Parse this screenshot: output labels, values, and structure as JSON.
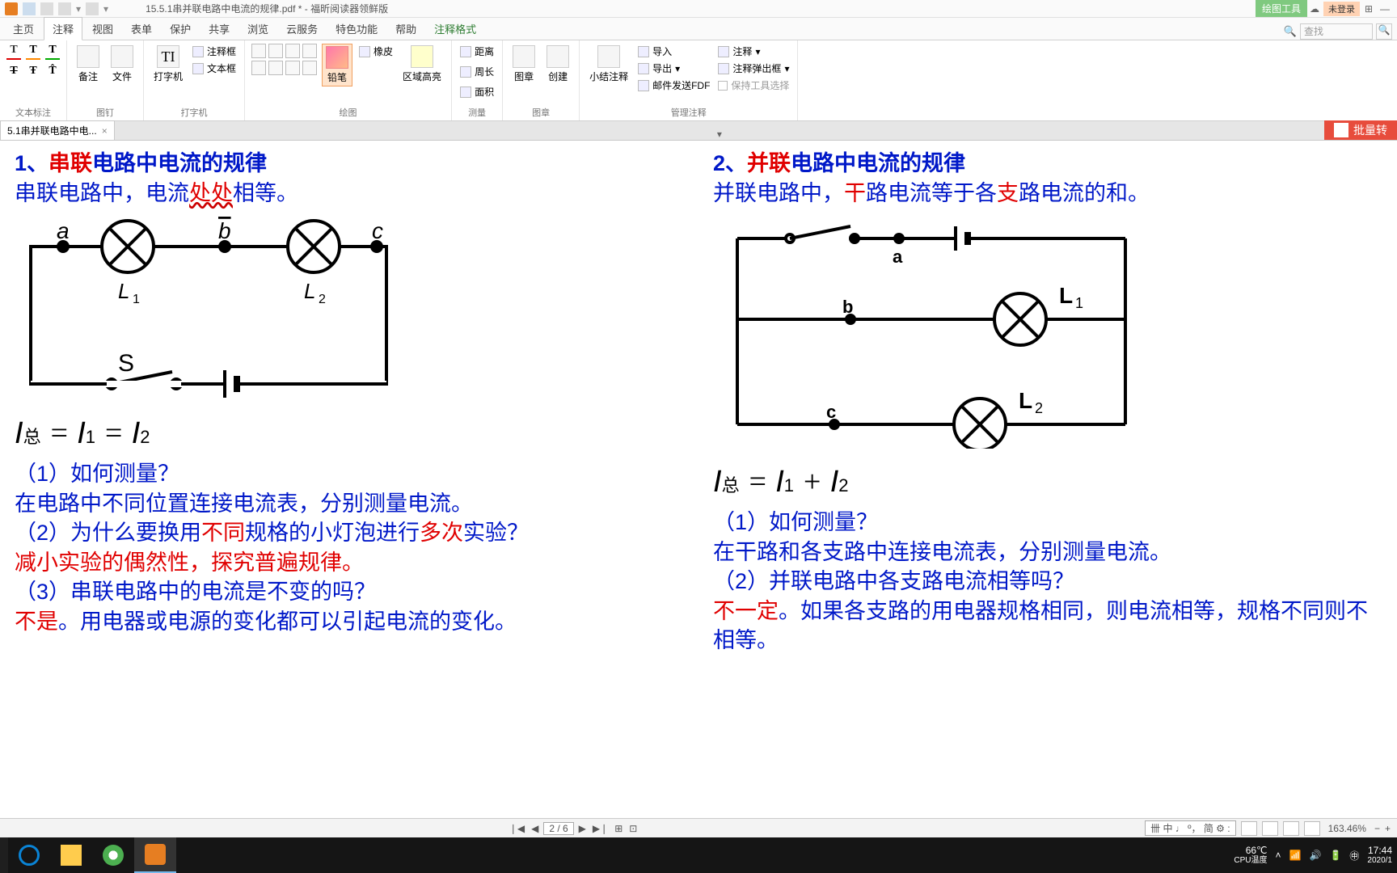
{
  "titlebar": {
    "doc_title": "15.5.1串并联电路中电流的规律.pdf * - 福昕阅读器领鲜版",
    "context_tab": "绘图工具",
    "login": "未登录"
  },
  "ribbon_tabs": [
    "主页",
    "注释",
    "视图",
    "表单",
    "保护",
    "共享",
    "浏览",
    "云服务",
    "特色功能",
    "帮助",
    "注释格式"
  ],
  "active_tab_index": 1,
  "search": {
    "placeholder": "查找"
  },
  "ribbon": {
    "groups": {
      "text_mark": "文本标注",
      "pin": "图钉",
      "typewriter": "打字机",
      "draw": "绘图",
      "measure": "测量",
      "stamp": "图章",
      "manage": "管理注释"
    },
    "btns": {
      "note": "备注",
      "file": "文件",
      "typewriter": "打字机",
      "annot_box": "注释框",
      "text_box": "文本框",
      "pencil": "铅笔",
      "pencil_active": true,
      "eraser": "橡皮",
      "area_hl": "区域高亮",
      "distance": "距离",
      "perimeter": "周长",
      "area": "面积",
      "stamp": "图章",
      "create": "创建",
      "summary": "小结注释",
      "import": "导入",
      "export": "导出",
      "send_fdf": "邮件发送FDF",
      "annot_cmd": "注释",
      "popup": "注释弹出框",
      "keep_tool": "保持工具选择"
    }
  },
  "doc_tab": {
    "label": "5.1串并联电路中电...",
    "right_pill": "批量转",
    "dropdown": "▾"
  },
  "content": {
    "left": {
      "h1a": "1、",
      "h1b": "串联",
      "h1c": "电路中电流的规律",
      "p1a": "串联电路中，电流",
      "p1b": "处处",
      "p1c": "相等。",
      "labels": {
        "a": "a",
        "b": "b",
        "c": "c",
        "L1": "L₁",
        "L2": "L₂",
        "S": "S"
      },
      "formula": "I总 = I₁ = I₂",
      "q1": "（1）如何测量？",
      "a1": "在电路中不同位置连接电流表，分别测量电流。",
      "q2a": "（2）为什么要换用",
      "q2b": "不同",
      "q2c": "规格的小灯泡进行",
      "q2d": "多次",
      "q2e": "实验？",
      "a2": "减小实验的偶然性，探究普遍规律。",
      "q3": "（3）串联电路中的电流是不变的吗？",
      "a3a": "不是",
      "a3b": "。用电器或电源的变化都可以引起电流的变化。"
    },
    "right": {
      "h1a": "2、",
      "h1b": "并联",
      "h1c": "电路中电流的规律",
      "p1a": "并联电路中，",
      "p1b": "干",
      "p1c": "路电流等于各",
      "p1d": "支",
      "p1e": "路电流的和。",
      "labels": {
        "a": "a",
        "b": "b",
        "c": "c",
        "L1": "L₁",
        "L2": "L₂"
      },
      "formula": "I总 = I₁ + I₂",
      "q1": "（1）如何测量？",
      "a1": "在干路和各支路中连接电流表，分别测量电流。",
      "q2": "（2）并联电路中各支路电流相等吗？",
      "a2a": "不一定",
      "a2b": "。如果各支路的用电器规格相同，则电流相等，规格不同则不相等。"
    }
  },
  "status": {
    "page": "2 / 6",
    "ime": "卌 中 ♩ º， 简 ⚙ :",
    "zoom": "163.46%",
    "nav": {
      "first": "❘◀",
      "prev": "◀",
      "next": "▶",
      "last": "▶❘"
    }
  },
  "taskbar": {
    "temp": "66℃",
    "temp_label": "CPU温度",
    "time": "17:44",
    "date": "2020/1"
  }
}
